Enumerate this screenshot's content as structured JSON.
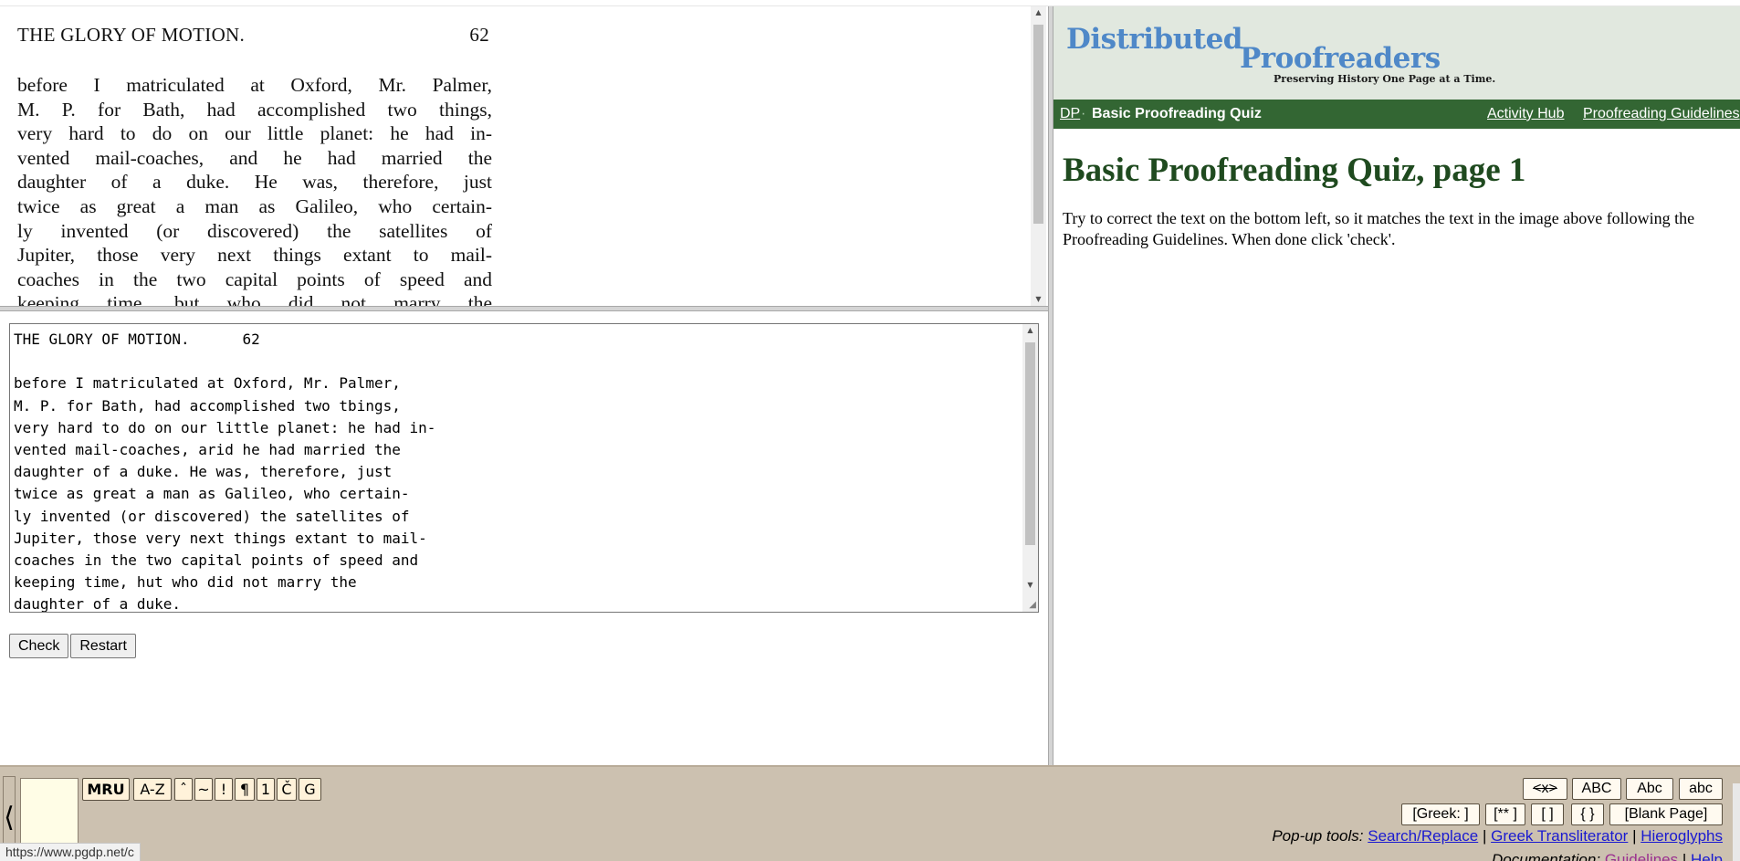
{
  "scan": {
    "header_title": "THE GLORY OF MOTION.",
    "header_page": "62",
    "lines": [
      "before I matriculated at Oxford, Mr. Palmer,",
      "M. P. for Bath, had accomplished two things,",
      "very hard to do on our little planet: he had in-",
      "vented mail-coaches, and he had married the",
      "daughter of a duke. He was, therefore, just",
      "twice as great a man as Galileo, who certain-",
      "ly invented (or discovered) the satellites of",
      "Jupiter, those very next things extant to mail-",
      "coaches in the two capital points of speed and",
      "keeping time, but who did not marry the"
    ]
  },
  "editor": {
    "text": "THE GLORY OF MOTION.      62\n\nbefore I matriculated at Oxford, Mr. Palmer,\nM. P. for Bath, had accomplished two tbings,\nvery hard to do on our little planet: he had in-\nvented mail-coaches, arid he had married the\ndaughter of a duke. He was, therefore, just\ntwice as great a man as Galileo, who certain-\nly invented (or discovered) the satellites of\nJupiter, those very next things extant to mail-\ncoaches in the two capital points of speed and\nkeeping time, hut who did not marry the\ndaughter of a duke."
  },
  "buttons": {
    "check": "Check",
    "restart": "Restart"
  },
  "site": {
    "logo_word1": "Distributed",
    "logo_bigd": "",
    "logo_word2": "Proofreaders",
    "tagline": "Preserving History One Page at a Time."
  },
  "nav": {
    "home": "DP",
    "sep": "·",
    "title": "Basic Proofreading Quiz",
    "activity_hub": "Activity Hub",
    "guidelines": "Proofreading Guidelines"
  },
  "page": {
    "heading": "Basic Proofreading Quiz, page 1",
    "intro": "Try to correct the text on the bottom left, so it matches the text in the image above following the Proofreading Guidelines. When done click 'check'."
  },
  "toolbar": {
    "collapse": "⟨",
    "tabs": [
      "MRU",
      "A-Z",
      "ˆ",
      "~",
      "!",
      "¶",
      "1",
      "Č",
      "G"
    ],
    "case_buttons": [
      "<x>",
      "ABC",
      "Abc",
      "abc"
    ],
    "markup_buttons": [
      "[Greek: ]",
      "[** ]",
      "[ ]",
      "{ }",
      "[Blank Page]"
    ],
    "popup_label": "Pop-up tools:",
    "popup_links": [
      "Search/Replace",
      "Greek Transliterator",
      "Hieroglyphs"
    ],
    "doc_label": "Documentation:",
    "doc_links": [
      "Guidelines",
      "Help"
    ],
    "sep": "|"
  },
  "status": {
    "url": "https://www.pgdp.net/c"
  },
  "colors": {
    "nav_green": "#336633",
    "heading_green": "#1f4a1f",
    "banner_bg": "#e1e8df",
    "logo_blue": "#4f88c8",
    "toolbar_bg": "#ccc1b0"
  }
}
